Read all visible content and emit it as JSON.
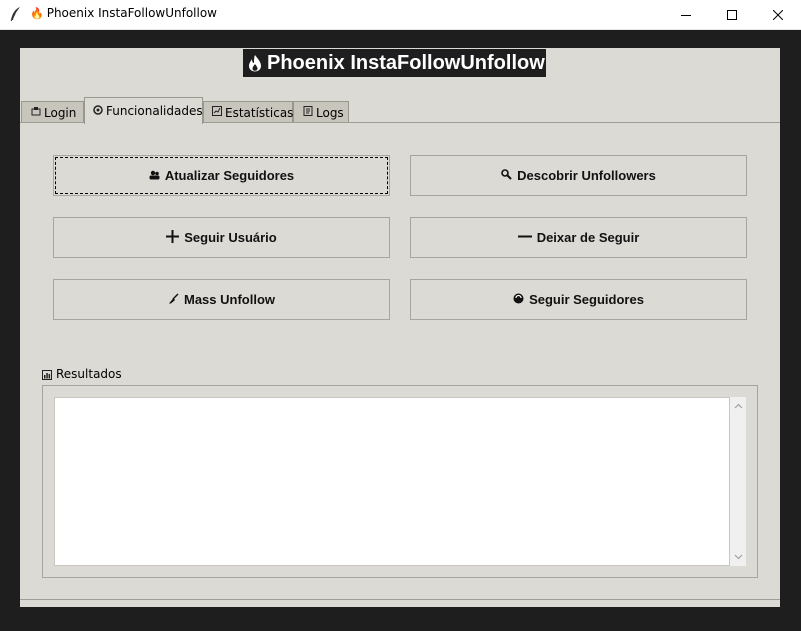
{
  "window": {
    "title": "Phoenix InstaFollowUnfollow",
    "title_glyph": "🔥",
    "controls": {
      "minimize": "minimize",
      "maximize": "maximize",
      "close": "close"
    }
  },
  "header": {
    "title": "Phoenix InstaFollowUnfollow"
  },
  "tabs": [
    {
      "label": "Login",
      "icon": "login-icon",
      "active": false
    },
    {
      "label": "Funcionalidades",
      "icon": "gear-icon",
      "active": true
    },
    {
      "label": "Estatísticas",
      "icon": "chart-icon",
      "active": false
    },
    {
      "label": "Logs",
      "icon": "log-icon",
      "active": false
    }
  ],
  "buttons": {
    "update_followers": {
      "label": "Atualizar Seguidores",
      "icon": "users-icon"
    },
    "discover_unfollowers": {
      "label": "Descobrir Unfollowers",
      "icon": "magnifier-icon"
    },
    "follow_user": {
      "label": "Seguir Usuário",
      "icon": "plus-icon"
    },
    "unfollow_user": {
      "label": "Deixar de Seguir",
      "icon": "minus-icon"
    },
    "mass_unfollow": {
      "label": "Mass Unfollow",
      "icon": "broom-icon"
    },
    "follow_followers": {
      "label": "Seguir Seguidores",
      "icon": "cycle-icon"
    }
  },
  "results": {
    "label": "Resultados",
    "content": ""
  },
  "colors": {
    "window_bg": "#dcdad5",
    "outer_bg": "#1e1e1e",
    "header_bg": "#1e1e1e",
    "header_fg": "#ffffff",
    "inactive_tab": "#c8c5bd"
  }
}
